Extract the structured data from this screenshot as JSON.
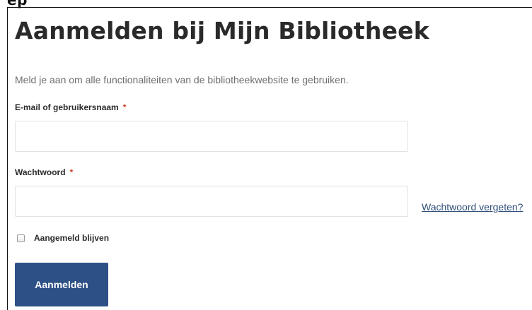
{
  "header": {
    "overflow_text": "ep",
    "title": "Aanmelden bij Mijn Bibliotheek",
    "intro": "Meld je aan om alle functionaliteiten van de bibliotheekwebsite te gebruiken."
  },
  "form": {
    "email": {
      "label": "E-mail of gebruikersnaam",
      "required_marker": "*",
      "value": ""
    },
    "password": {
      "label": "Wachtwoord",
      "required_marker": "*",
      "value": ""
    },
    "forgot_link": "Wachtwoord vergeten?",
    "remember_me": {
      "label": "Aangemeld blijven",
      "checked": false
    },
    "submit_label": "Aanmelden"
  },
  "colors": {
    "button": "#2d5086",
    "link": "#2f4f7a",
    "required": "#d0402e"
  }
}
